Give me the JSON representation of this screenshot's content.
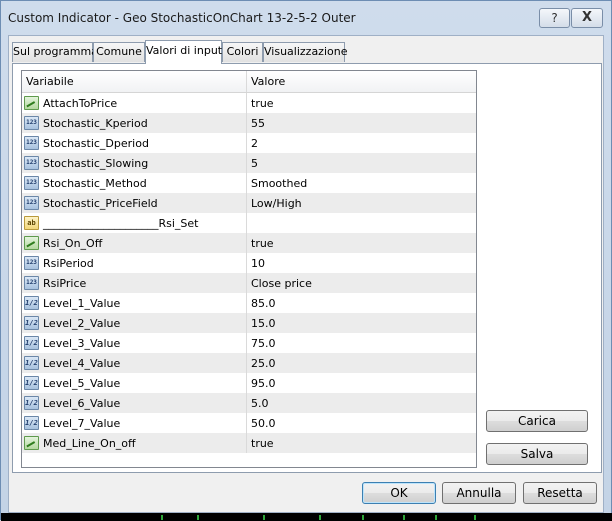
{
  "window": {
    "title": "Custom Indicator - Geo StochasticOnChart 13-2-5-2 Outer",
    "help_label": "?",
    "close_label": "X"
  },
  "tabs": [
    {
      "label": "Sul programma",
      "active": false
    },
    {
      "label": "Comune",
      "active": false
    },
    {
      "label": "Valori di input",
      "active": true
    },
    {
      "label": "Colori",
      "active": false
    },
    {
      "label": "Visualizzazione",
      "active": false
    }
  ],
  "grid": {
    "columns": {
      "variable": "Variabile",
      "value": "Valore"
    },
    "rows": [
      {
        "icon": "bool",
        "name": "AttachToPrice",
        "value": "true"
      },
      {
        "icon": "int",
        "name": "Stochastic_Kperiod",
        "value": "55"
      },
      {
        "icon": "int",
        "name": "Stochastic_Dperiod",
        "value": "2"
      },
      {
        "icon": "int",
        "name": "Stochastic_Slowing",
        "value": "5"
      },
      {
        "icon": "int",
        "name": "Stochastic_Method",
        "value": "Smoothed"
      },
      {
        "icon": "int",
        "name": "Stochastic_PriceField",
        "value": "Low/High"
      },
      {
        "icon": "str",
        "name": "_____________________Rsi_Set",
        "value": ""
      },
      {
        "icon": "bool",
        "name": "Rsi_On_Off",
        "value": "true"
      },
      {
        "icon": "int",
        "name": "RsiPeriod",
        "value": "10"
      },
      {
        "icon": "int",
        "name": "RsiPrice",
        "value": "Close price"
      },
      {
        "icon": "dbl",
        "name": "Level_1_Value",
        "value": "85.0"
      },
      {
        "icon": "dbl",
        "name": "Level_2_Value",
        "value": "15.0"
      },
      {
        "icon": "dbl",
        "name": "Level_3_Value",
        "value": "75.0"
      },
      {
        "icon": "dbl",
        "name": "Level_4_Value",
        "value": "25.0"
      },
      {
        "icon": "dbl",
        "name": "Level_5_Value",
        "value": "95.0"
      },
      {
        "icon": "dbl",
        "name": "Level_6_Value",
        "value": "5.0"
      },
      {
        "icon": "dbl",
        "name": "Level_7_Value",
        "value": "50.0"
      },
      {
        "icon": "bool",
        "name": "Med_Line_On_off",
        "value": "true"
      }
    ]
  },
  "icon_glyphs": {
    "int": "123",
    "dbl": "1/2",
    "str": "ab",
    "bool": ""
  },
  "buttons": {
    "load": "Carica",
    "save": "Salva",
    "ok": "OK",
    "cancel": "Annulla",
    "reset": "Resetta"
  }
}
